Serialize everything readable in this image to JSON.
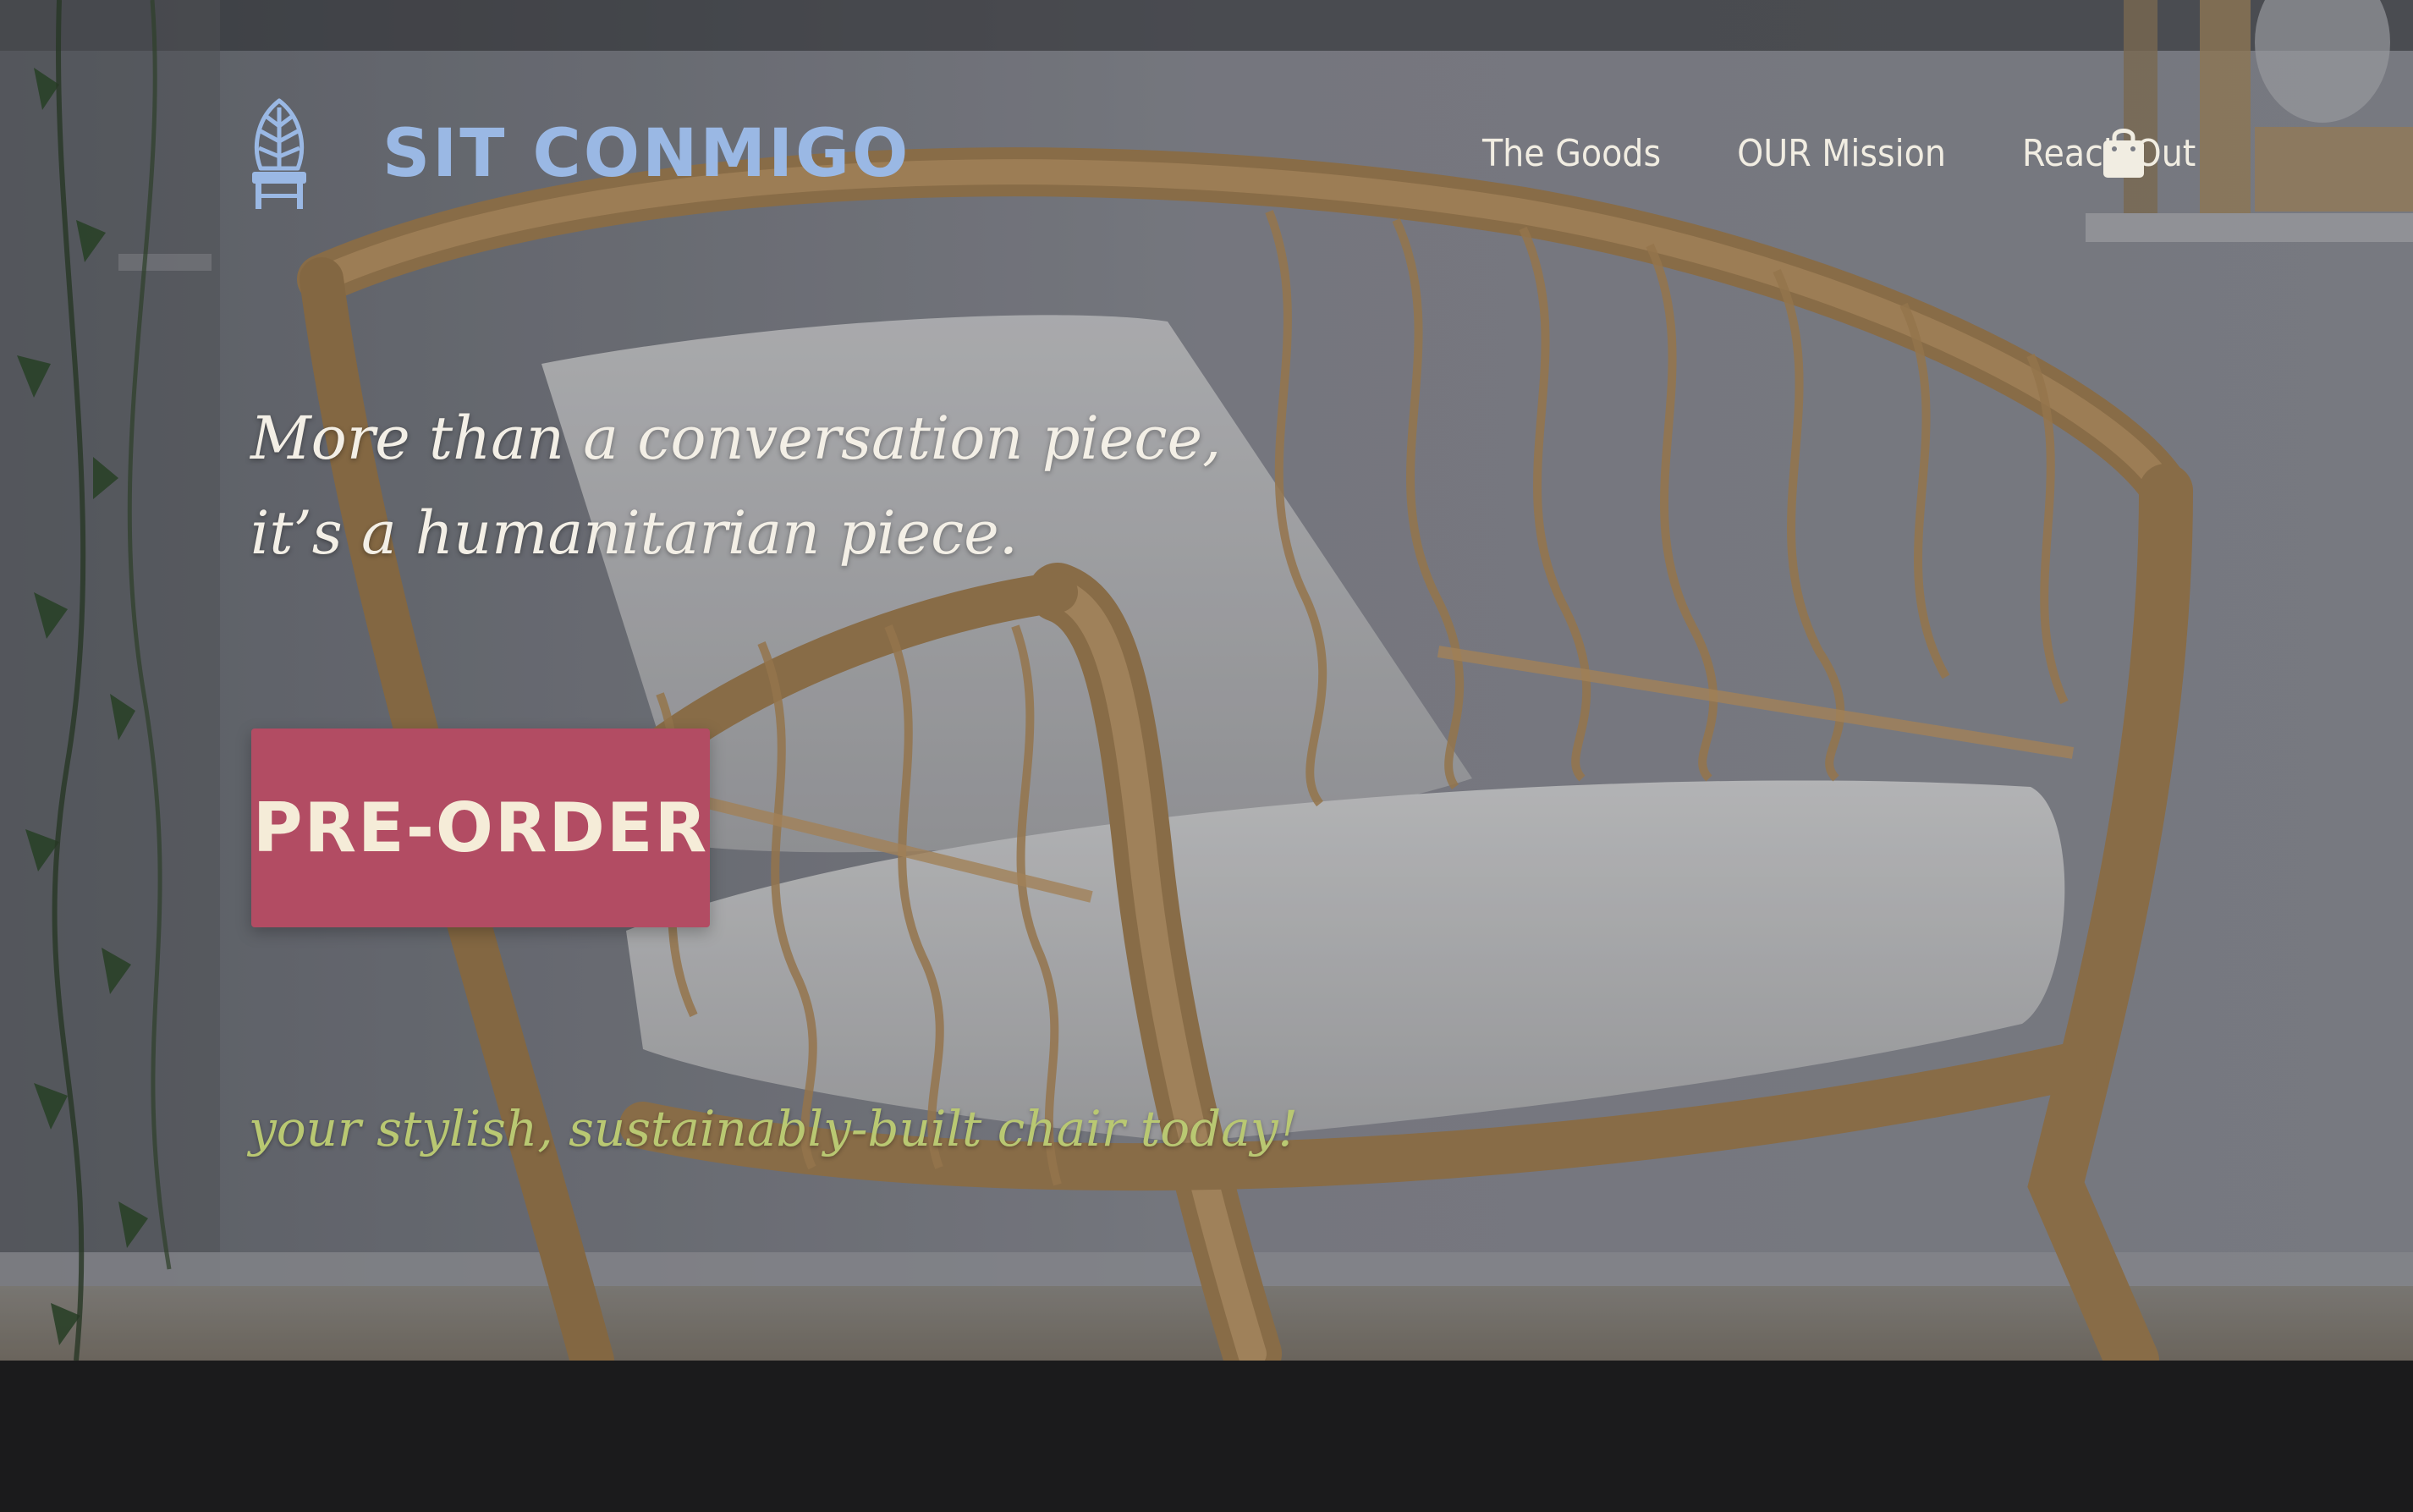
{
  "brand": {
    "name": "SIT CONMIGO",
    "logo_icon": "leaf-chair-icon",
    "color": "#9ab8e4"
  },
  "nav": {
    "items": [
      {
        "label": "The Goods"
      },
      {
        "label": "OUR Mission"
      },
      {
        "label": "Reach Out"
      }
    ],
    "cart_icon": "shopping-bag-icon"
  },
  "hero": {
    "tagline_line1": "More than a conversation piece,",
    "tagline_line2": "it’s a humanitarian piece.",
    "cta_label": "PRE-ORDER",
    "cta_color": "#b24c63",
    "subline": "your stylish, sustainably-built chair today!",
    "subline_color": "#b9c872",
    "image": "rattan-armchair-with-white-cushions-photo"
  }
}
